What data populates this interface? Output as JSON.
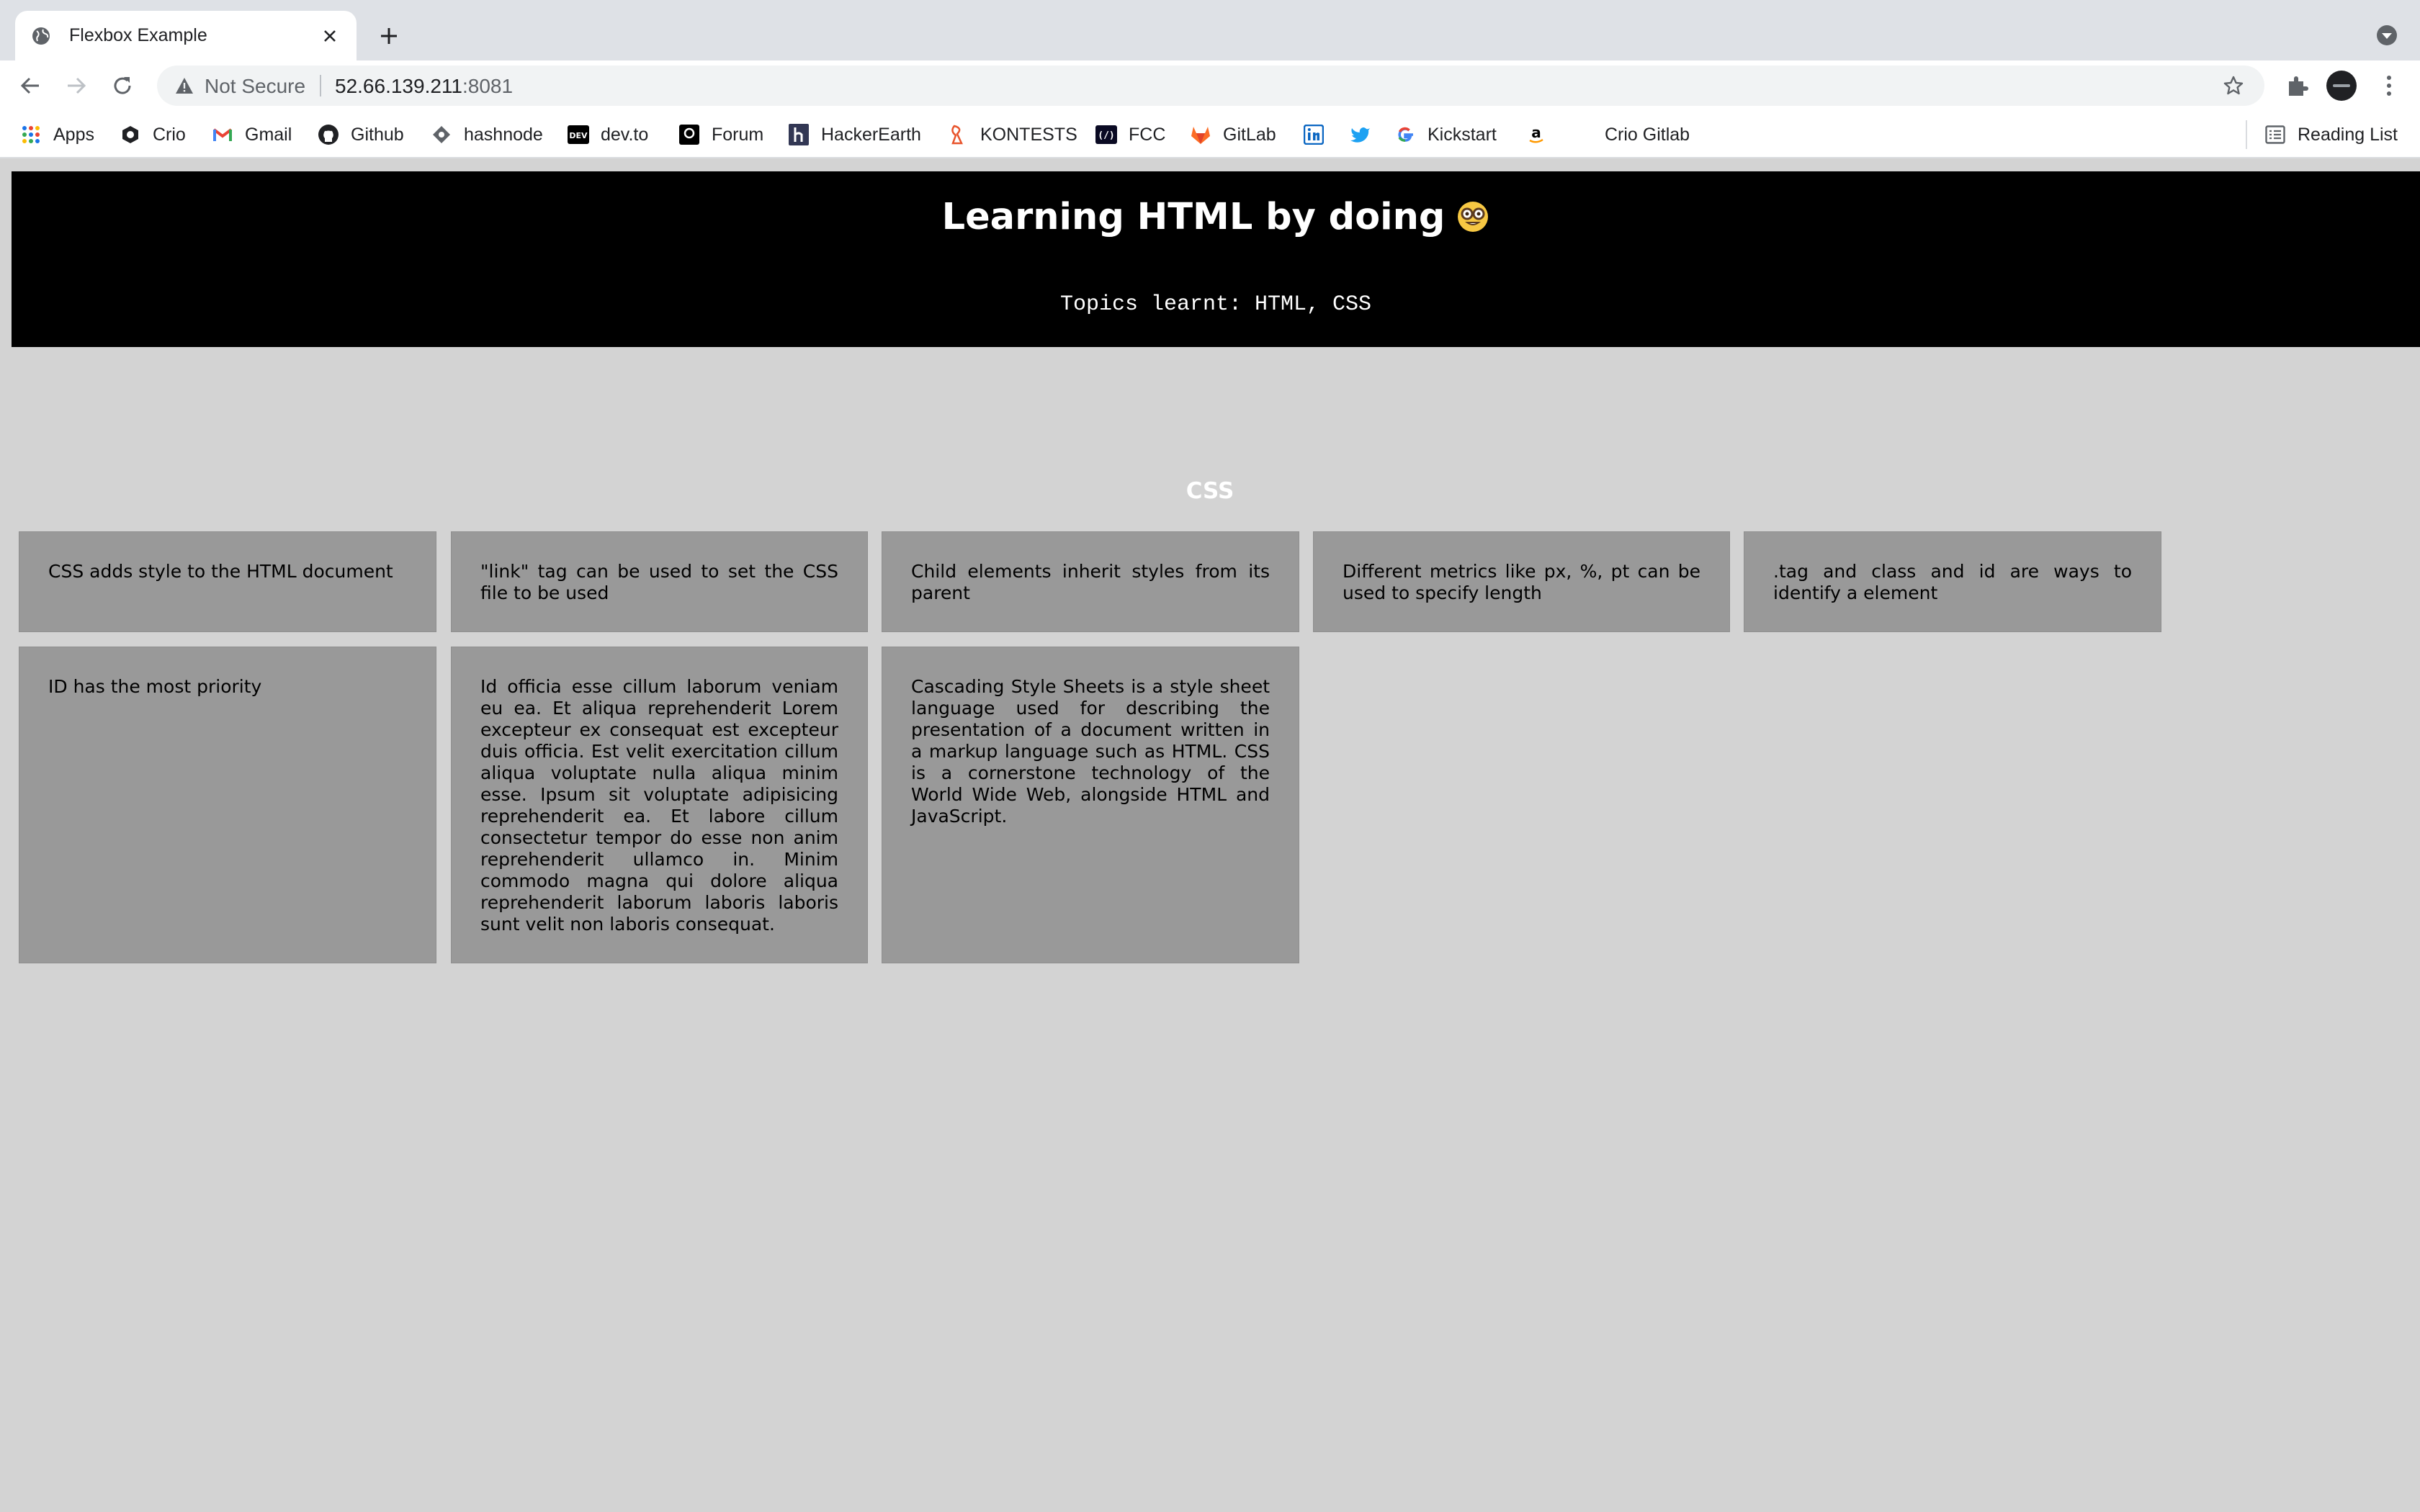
{
  "browser": {
    "tab_title": "Flexbox Example",
    "security_label": "Not Secure",
    "url_host": "52.66.139.211",
    "url_port": ":8081"
  },
  "bookmarks": [
    {
      "label": "Apps",
      "icon": "apps-grid-icon"
    },
    {
      "label": "Crio",
      "icon": "crio-icon"
    },
    {
      "label": "Gmail",
      "icon": "gmail-icon"
    },
    {
      "label": "Github",
      "icon": "github-icon"
    },
    {
      "label": "hashnode",
      "icon": "hashnode-icon"
    },
    {
      "label": "dev.to",
      "icon": "devto-icon"
    },
    {
      "label": "Forum",
      "icon": "forum-icon"
    },
    {
      "label": "HackerEarth",
      "icon": "hackerearth-icon"
    },
    {
      "label": "KONTESTS",
      "icon": "kontests-icon"
    },
    {
      "label": "FCC",
      "icon": "fcc-icon"
    },
    {
      "label": "GitLab",
      "icon": "gitlab-icon"
    },
    {
      "label": "",
      "icon": "linkedin-icon"
    },
    {
      "label": "",
      "icon": "twitter-icon"
    },
    {
      "label": "Kickstart",
      "icon": "google-icon"
    },
    {
      "label": "",
      "icon": "amazon-icon"
    },
    {
      "label": "Crio Gitlab",
      "icon": ""
    },
    {
      "label": "Reading List",
      "icon": "reading-list-icon"
    }
  ],
  "page": {
    "title": "Learning HTML by doing",
    "title_emoji": "nerd-face-emoji",
    "subtitle": "Topics learnt: HTML, CSS",
    "section_heading": "CSS",
    "cards": [
      {
        "text": "CSS adds style to the HTML document"
      },
      {
        "text": "\"link\" tag can be used to set the CSS file to be used"
      },
      {
        "text": "Child elements inherit styles from its parent"
      },
      {
        "text": "Different metrics like px, %, pt can be used to specify length"
      },
      {
        "text": ".tag and class and id are ways to identify a element"
      },
      {
        "text": "ID has the most priority"
      },
      {
        "text": "Id officia esse cillum laborum veniam eu ea. Et aliqua reprehenderit Lorem excepteur ex consequat est excepteur duis officia. Est velit exercitation cillum aliqua voluptate nulla aliqua minim esse. Ipsum sit voluptate adipisicing reprehenderit ea. Et labore cillum consectetur tempor do esse non anim reprehenderit ullamco in. Minim commodo magna qui dolore aliqua reprehenderit laborum laboris laboris sunt velit non laboris consequat."
      },
      {
        "text": "Cascading Style Sheets is a style sheet language used for describing the presentation of a document written in a markup language such as HTML. CSS is a cornerstone technology of the World Wide Web, alongside HTML and JavaScript."
      }
    ]
  },
  "colors": {
    "page_background": "#d3d3d3",
    "header_background": "#000000",
    "card_background": "#999999",
    "heading_text": "#ffffff"
  }
}
